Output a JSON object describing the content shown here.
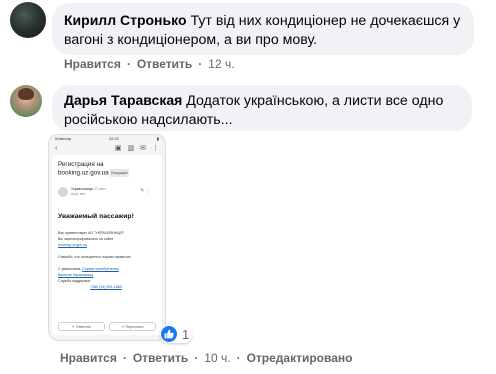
{
  "comments": [
    {
      "author": "Кирилл Стронько",
      "text": "Тут від них кондиціонер не дочекаєшся у вагоні з кондиціонером, а ви про мову.",
      "like_label": "Нравится",
      "reply_label": "Ответить",
      "time": "12 ч."
    },
    {
      "author": "Дарья Таравская",
      "text": "Додаток українською, а листи все одно російською надсилають...",
      "like_label": "Нравится",
      "reply_label": "Ответить",
      "time": "10 ч.",
      "edited": "Отредактировано",
      "reaction_count": "1",
      "attachment": {
        "status_left": "Київстар",
        "status_time": "22:22",
        "subject_line1": "Регистрация на",
        "subject_line2": "booking.uz.gov.ua",
        "inbox_badge": "Входящие",
        "sender": "Укрзалізниця",
        "sender_time": "27 июл",
        "sender_sub": "кому: мне",
        "heading": "Уважаемый пассажир!",
        "lines": [
          "Вас приветствует АО \"УКРЗАЛІЗНИЦЯ\"",
          "Вы зарегистрировались на сайте",
          "booking.uz.gov.ua",
          "Спасибо, что пользуетесь нашим сервисом",
          "С уважением,",
          "Сервис приобретения",
          "билетов Укрзалізниці",
          "Служба поддержки:",
          "+380 (44) 591-1868"
        ],
        "reply_btn": "Ответить",
        "forward_btn": "Переслать"
      }
    }
  ]
}
